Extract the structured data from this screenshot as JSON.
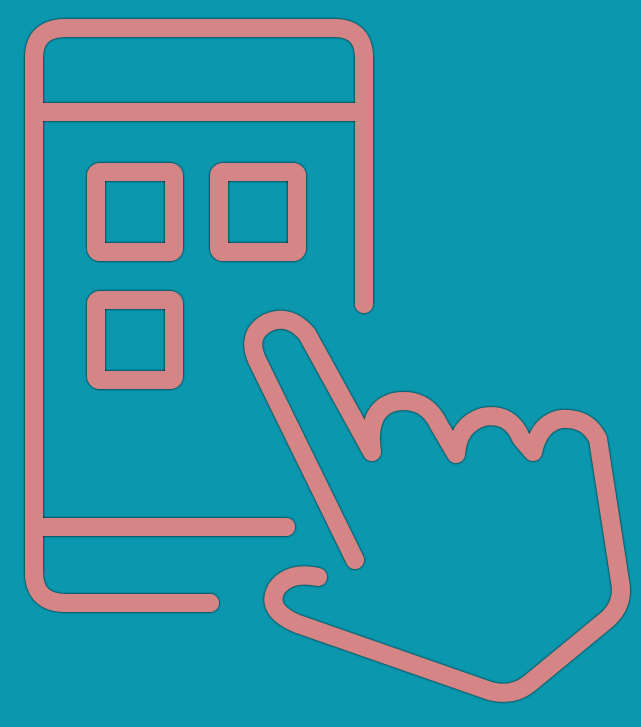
{
  "graphic": {
    "icon_name": "tap-app-icon",
    "background_color": "#0b98ae",
    "stroke_color": "#d58585",
    "glow_color": "#98b7b9"
  }
}
